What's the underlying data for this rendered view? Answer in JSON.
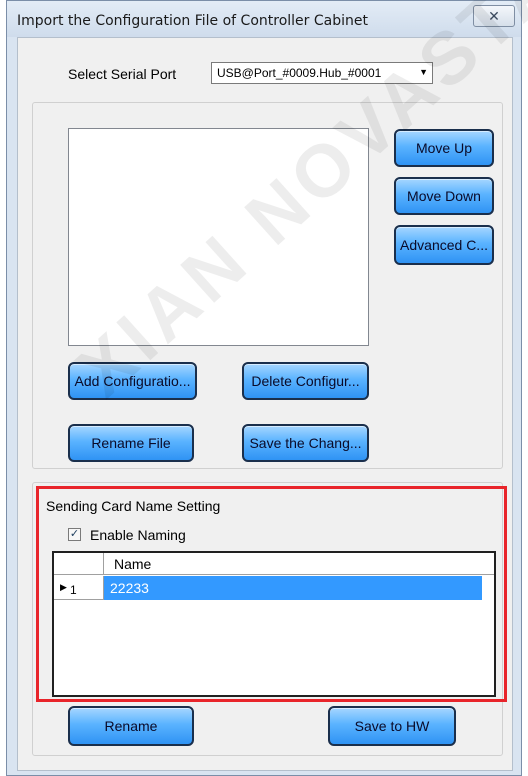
{
  "window": {
    "title": "Import the Configuration File of Controller Cabinet",
    "close_glyph": "✕"
  },
  "serial_port": {
    "label": "Select Serial Port",
    "selected_value": "USB@Port_#0009.Hub_#0001"
  },
  "config_files": {
    "items": [],
    "buttons": {
      "move_up": "Move Up",
      "move_down": "Move Down",
      "advanced": "Advanced C...",
      "add": "Add Configuratio...",
      "delete": "Delete Configur...",
      "rename_file": "Rename File",
      "save_changes": "Save the Chang..."
    }
  },
  "sending_card": {
    "group_title": "Sending Card Name Setting",
    "enable_naming_label": "Enable Naming",
    "enable_naming_checked": true,
    "grid": {
      "column_header": "Name",
      "rows": [
        {
          "index": "1",
          "name": "22233",
          "selected": true
        }
      ]
    },
    "buttons": {
      "rename": "Rename",
      "save_to_hw": "Save to HW"
    }
  },
  "watermark_text": "XIAN NOVASTAR",
  "colors": {
    "button_blue": "#5ab3ff",
    "selection_blue": "#3399ff",
    "highlight_red": "#e8242a"
  }
}
